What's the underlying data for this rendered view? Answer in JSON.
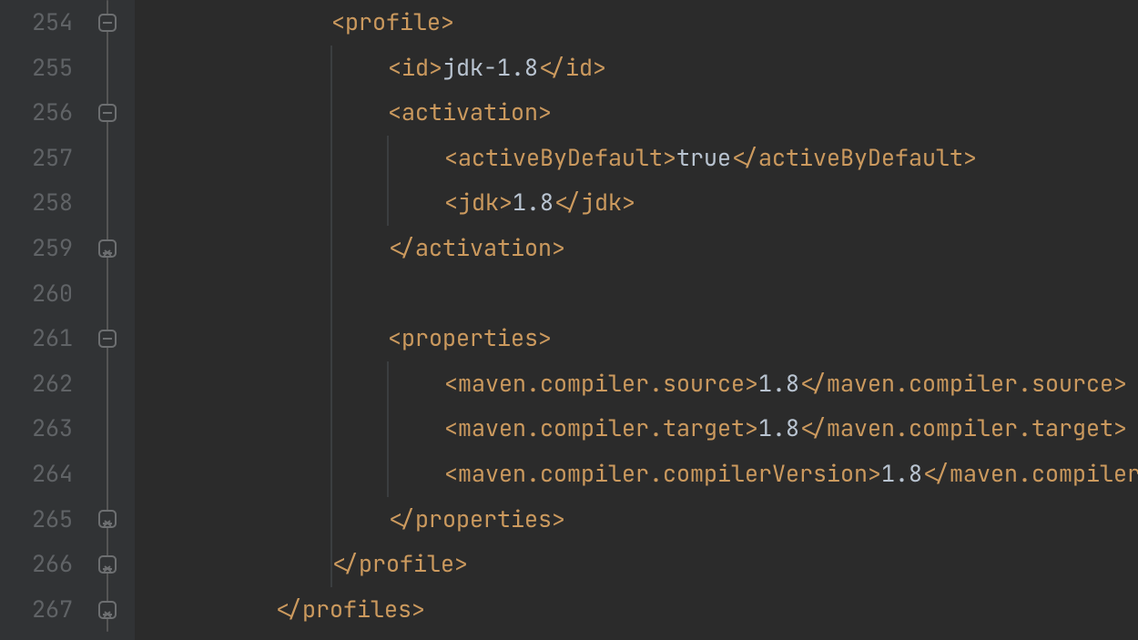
{
  "colors": {
    "background": "#2b2b2b",
    "gutter_bg": "#313335",
    "gutter_fg": "#606366",
    "tag": "#cc9a5e",
    "text": "#b9c4d1",
    "indent_guide": "#3b3e40",
    "fold_border": "#6d6f71"
  },
  "editor": {
    "line_numbers": [
      "254",
      "255",
      "256",
      "257",
      "258",
      "259",
      "260",
      "261",
      "262",
      "263",
      "264",
      "265",
      "266",
      "267"
    ],
    "fold_regions": [
      {
        "type": "open",
        "line": 254
      },
      {
        "type": "open",
        "line": 256
      },
      {
        "type": "close",
        "line": 259
      },
      {
        "type": "open",
        "line": 261
      },
      {
        "type": "close",
        "line": 265
      },
      {
        "type": "close",
        "line": 266
      },
      {
        "type": "close",
        "line": 267
      }
    ],
    "lines": [
      {
        "indent": 3,
        "segments": [
          {
            "kind": "tag",
            "text": "<profile>"
          }
        ]
      },
      {
        "indent": 4,
        "segments": [
          {
            "kind": "tag",
            "text": "<id>"
          },
          {
            "kind": "txt",
            "text": "jdk-1.8"
          },
          {
            "kind": "tag",
            "text": "</id>"
          }
        ]
      },
      {
        "indent": 4,
        "segments": [
          {
            "kind": "tag",
            "text": "<activation>"
          }
        ]
      },
      {
        "indent": 5,
        "segments": [
          {
            "kind": "tag",
            "text": "<activeByDefault>"
          },
          {
            "kind": "txt",
            "text": "true"
          },
          {
            "kind": "tag",
            "text": "</activeByDefault>"
          }
        ]
      },
      {
        "indent": 5,
        "segments": [
          {
            "kind": "tag",
            "text": "<jdk>"
          },
          {
            "kind": "txt",
            "text": "1.8"
          },
          {
            "kind": "tag",
            "text": "</jdk>"
          }
        ]
      },
      {
        "indent": 4,
        "segments": [
          {
            "kind": "tag",
            "text": "</activation>"
          }
        ]
      },
      {
        "indent": 0,
        "segments": []
      },
      {
        "indent": 4,
        "segments": [
          {
            "kind": "tag",
            "text": "<properties>"
          }
        ]
      },
      {
        "indent": 5,
        "segments": [
          {
            "kind": "tag",
            "text": "<maven.compiler.source>"
          },
          {
            "kind": "txt",
            "text": "1.8"
          },
          {
            "kind": "tag",
            "text": "</maven.compiler.source>"
          }
        ]
      },
      {
        "indent": 5,
        "segments": [
          {
            "kind": "tag",
            "text": "<maven.compiler.target>"
          },
          {
            "kind": "txt",
            "text": "1.8"
          },
          {
            "kind": "tag",
            "text": "</maven.compiler.target>"
          }
        ]
      },
      {
        "indent": 5,
        "segments": [
          {
            "kind": "tag",
            "text": "<maven.compiler.compilerVersion>"
          },
          {
            "kind": "txt",
            "text": "1.8"
          },
          {
            "kind": "tag",
            "text": "</maven.compiler.compilerVersion>"
          }
        ]
      },
      {
        "indent": 4,
        "segments": [
          {
            "kind": "tag",
            "text": "</properties>"
          }
        ]
      },
      {
        "indent": 3,
        "segments": [
          {
            "kind": "tag",
            "text": "</profile>"
          }
        ]
      },
      {
        "indent": 2,
        "segments": [
          {
            "kind": "tag",
            "text": "</profiles>"
          }
        ]
      }
    ]
  }
}
